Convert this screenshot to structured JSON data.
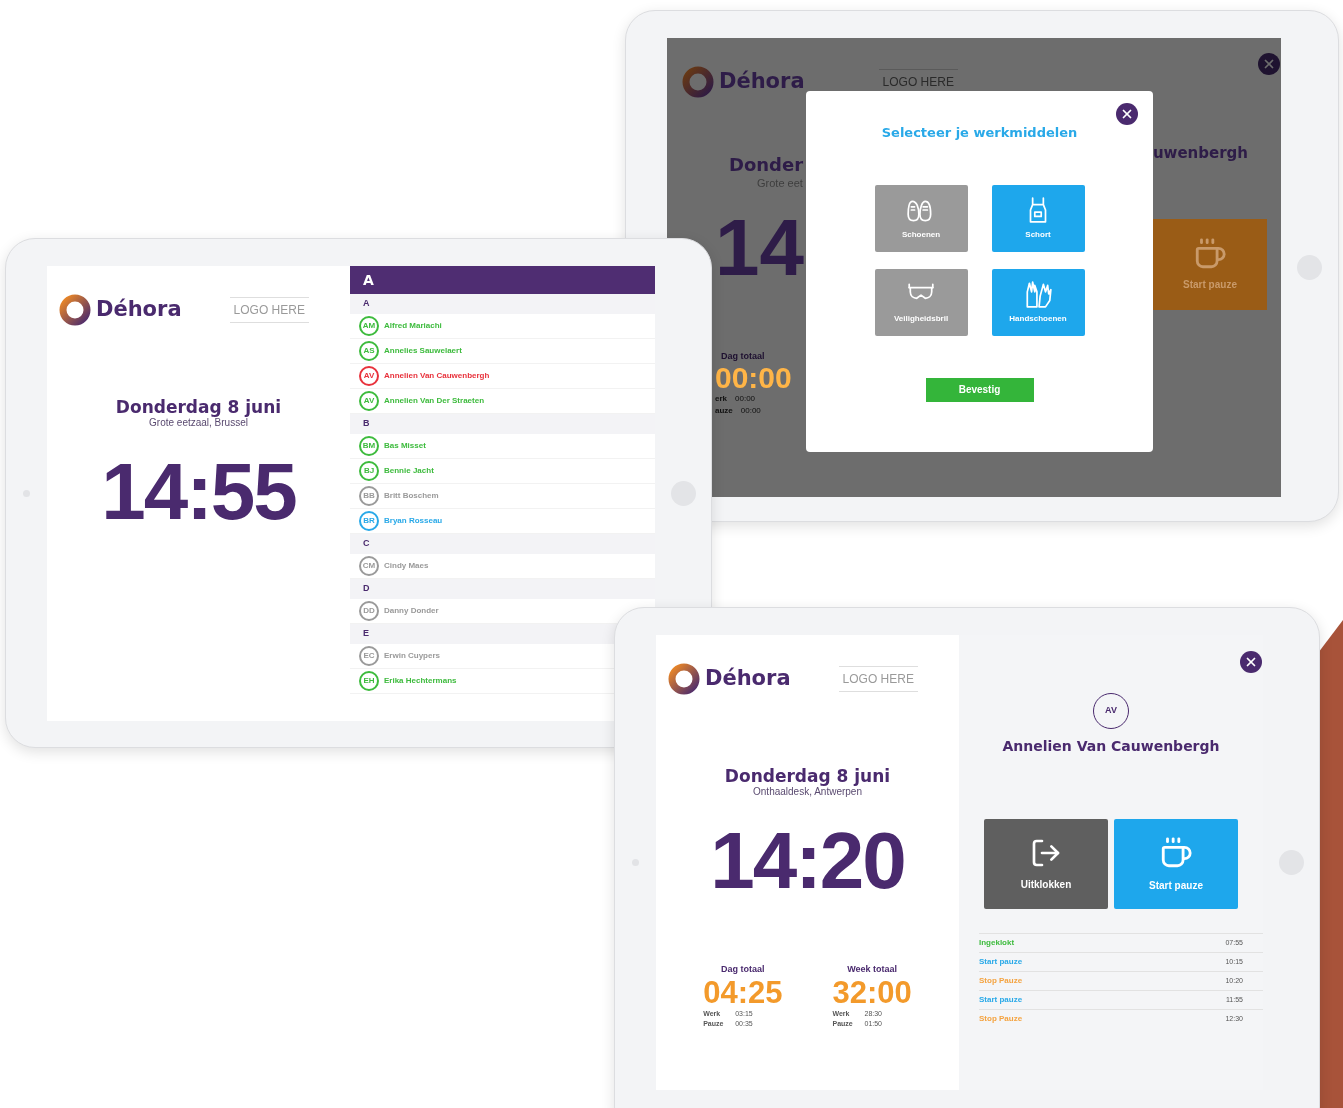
{
  "dialog_screen": {
    "logo": "Déhora",
    "logo_placeholder": "LOGO HERE",
    "date_fragment": "Donder",
    "location_fragment": "Grote eet",
    "clock_fragment": "14",
    "day_total_label": "Dag totaal",
    "day_total": "00:00",
    "work_fragment": "erk",
    "work_value": "00:00",
    "pause_fragment": "auze",
    "pause_value": "00:00",
    "name_fragment": "uwenbergh",
    "pause_button": "Start pauze",
    "dialog": {
      "title": "Selecteer je werkmiddelen",
      "confirm": "Bevestig",
      "tools": [
        {
          "kind": "shoes",
          "label": "Schoenen",
          "selected": false
        },
        {
          "kind": "apron",
          "label": "Schort",
          "selected": true
        },
        {
          "kind": "goggles",
          "label": "Veiligheidsbril",
          "selected": false
        },
        {
          "kind": "gloves",
          "label": "Handschoenen",
          "selected": true
        }
      ]
    }
  },
  "list_screen": {
    "logo": "Déhora",
    "logo_placeholder": "LOGO HERE",
    "date": "Donderdag 8 juni",
    "location": "Grote eetzaal, Brussel",
    "clock": "14:55",
    "index_letter": "A",
    "sections": [
      {
        "letter": "A",
        "people": [
          {
            "initials": "AM",
            "name": "Alfred Mariachi",
            "color": "#3dbb3d"
          },
          {
            "initials": "AS",
            "name": "Annelies Sauwelaert",
            "color": "#3dbb3d"
          },
          {
            "initials": "AV",
            "name": "Annelien Van Cauwenbergh",
            "color": "#e8323c"
          },
          {
            "initials": "AV",
            "name": "Annelien Van Der Straeten",
            "color": "#3dbb3d"
          }
        ]
      },
      {
        "letter": "B",
        "people": [
          {
            "initials": "BM",
            "name": "Bas Misset",
            "color": "#3dbb3d"
          },
          {
            "initials": "BJ",
            "name": "Bennie Jacht",
            "color": "#3dbb3d"
          },
          {
            "initials": "BB",
            "name": "Britt Boschem",
            "color": "#9a9a9a"
          },
          {
            "initials": "BR",
            "name": "Bryan Rosseau",
            "color": "#29a9e8"
          }
        ]
      },
      {
        "letter": "C",
        "people": [
          {
            "initials": "CM",
            "name": "Cindy Maes",
            "color": "#9a9a9a"
          }
        ]
      },
      {
        "letter": "D",
        "people": [
          {
            "initials": "DD",
            "name": "Danny Donder",
            "color": "#9a9a9a"
          }
        ]
      },
      {
        "letter": "E",
        "people": [
          {
            "initials": "EC",
            "name": "Erwin Cuypers",
            "color": "#9a9a9a"
          },
          {
            "initials": "EH",
            "name": "Erika Hechtermans",
            "color": "#3dbb3d"
          }
        ]
      }
    ]
  },
  "employee_screen": {
    "logo": "Déhora",
    "logo_placeholder": "LOGO HERE",
    "date": "Donderdag 8 juni",
    "location": "Onthaaldesk, Antwerpen",
    "clock": "14:20",
    "totals": [
      {
        "label": "Dag totaal",
        "value": "04:25",
        "work_label": "Werk",
        "work": "03:15",
        "pause_label": "Pauze",
        "pause": "00:35"
      },
      {
        "label": "Week totaal",
        "value": "32:00",
        "work_label": "Werk",
        "work": "28:30",
        "pause_label": "Pauze",
        "pause": "01:50"
      }
    ],
    "initials": "AV",
    "name": "Annelien Van Cauwenbergh",
    "actions": [
      {
        "kind": "clock_out",
        "label": "Uitklokken"
      },
      {
        "kind": "pause",
        "label": "Start pauze"
      }
    ],
    "log": [
      {
        "event": "Ingeklokt",
        "time": "07:55",
        "color": "#3dbb3d"
      },
      {
        "event": "Start pauze",
        "time": "10:15",
        "color": "#29a9e8"
      },
      {
        "event": "Stop Pauze",
        "time": "10:20",
        "color": "#f4a340"
      },
      {
        "event": "Start pauze",
        "time": "11:55",
        "color": "#29a9e8"
      },
      {
        "event": "Stop Pauze",
        "time": "12:30",
        "color": "#f4a340"
      }
    ]
  }
}
